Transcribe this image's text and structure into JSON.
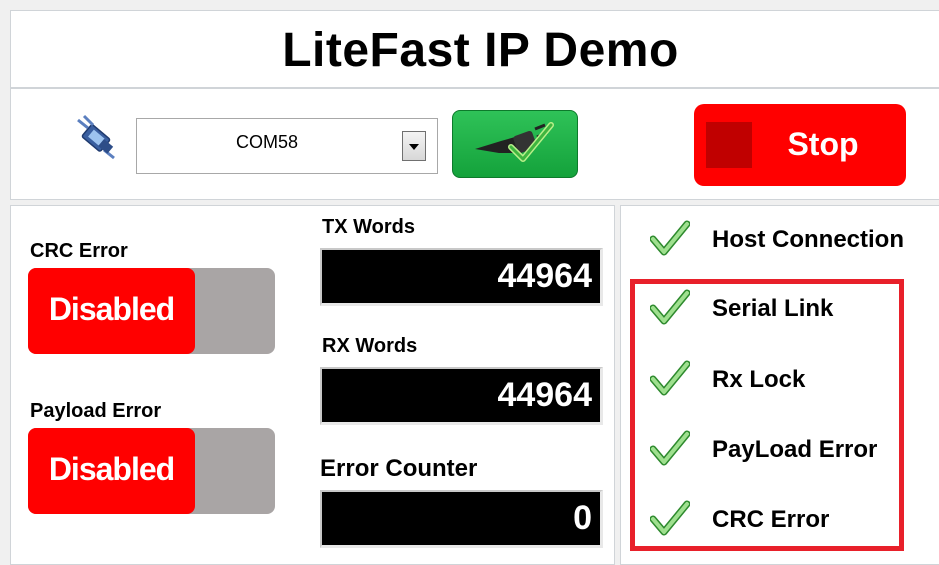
{
  "app": {
    "title": "LiteFast IP Demo"
  },
  "connection": {
    "port_value": "COM58",
    "port_icon": "serial-port-icon",
    "connect_icon": "plug-check-icon",
    "stop_label": "Stop"
  },
  "error_injection": {
    "crc": {
      "label": "CRC Error",
      "state": "Disabled"
    },
    "payload": {
      "label": "Payload Error",
      "state": "Disabled"
    }
  },
  "counters": {
    "tx": {
      "label": "TX Words",
      "value": "44964"
    },
    "rx": {
      "label": "RX Words",
      "value": "44964"
    },
    "errors": {
      "label": "Error Counter",
      "value": "0"
    }
  },
  "status": {
    "host": "Host Connection",
    "serial_link": "Serial Link",
    "rx_lock": "Rx Lock",
    "payload_error": "PayLoad Error",
    "crc_error": "CRC Error"
  },
  "colors": {
    "accent_red": "#ff0000",
    "connect_green": "#1db347",
    "highlight_border": "#e8202a",
    "check_green": "#5cc85c"
  }
}
